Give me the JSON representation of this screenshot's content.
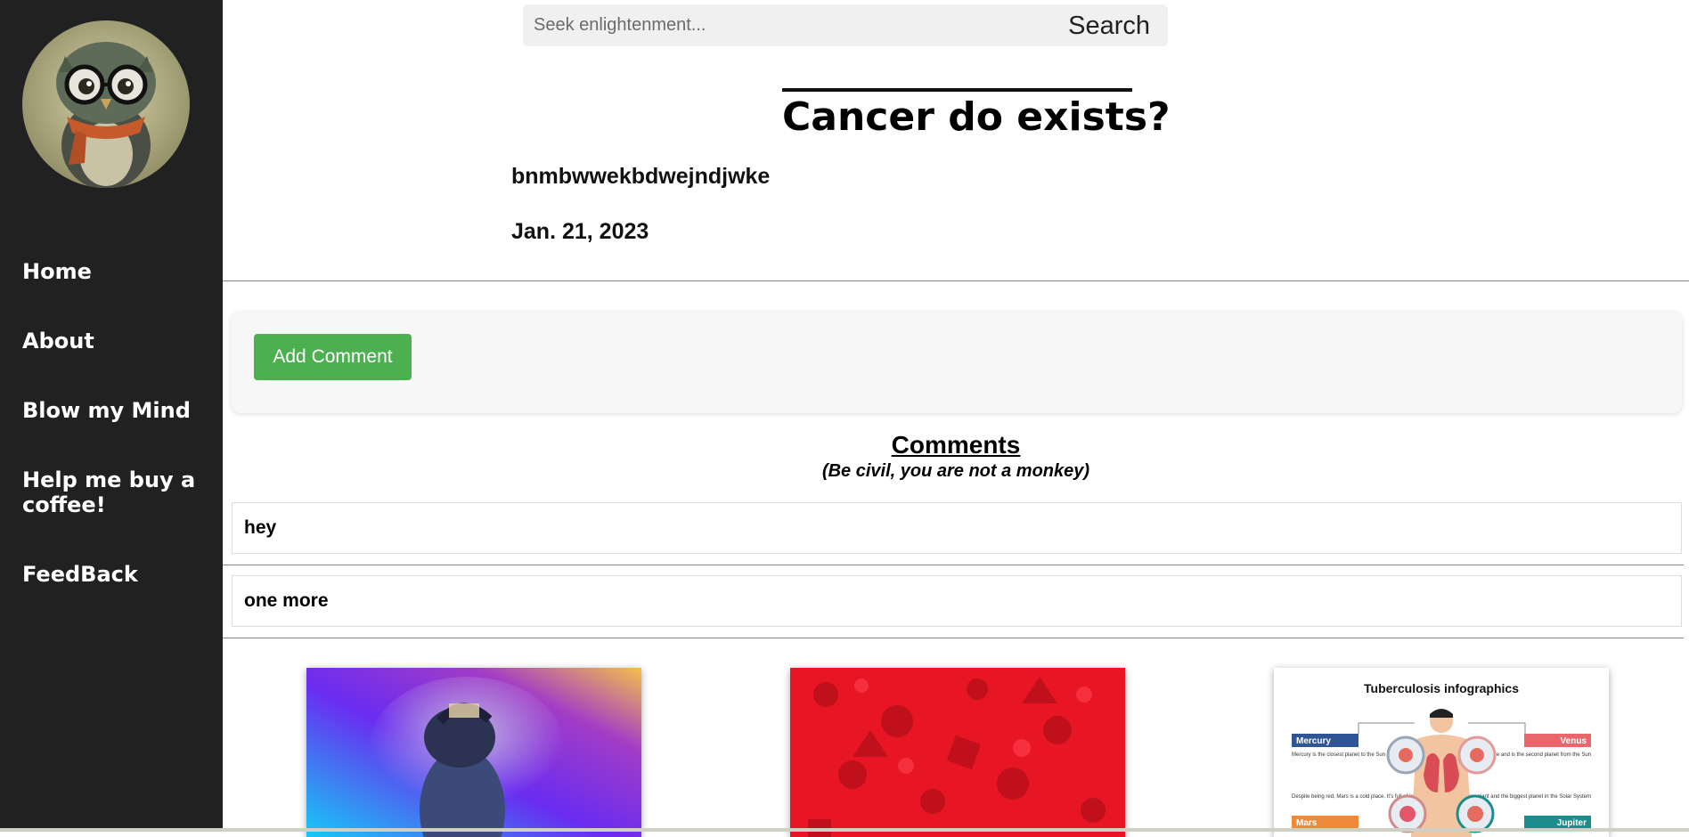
{
  "sidebar": {
    "items": [
      {
        "label": "Home"
      },
      {
        "label": "About"
      },
      {
        "label": "Blow my Mind"
      },
      {
        "label": "Help me buy a coffee!"
      },
      {
        "label": "FeedBack"
      }
    ]
  },
  "search": {
    "placeholder": "Seek enlightenment...",
    "button_label": "Search"
  },
  "post": {
    "title": "Cancer do exists?",
    "body": "bnmbwwekbdwejndjwke",
    "date": "Jan. 21, 2023"
  },
  "add_comment_label": "Add Comment",
  "comments": {
    "heading": "Comments",
    "subheading": "(Be civil, you are not a monkey)",
    "items": [
      {
        "text": "hey"
      },
      {
        "text": "one more"
      }
    ]
  },
  "related": {
    "infographic": {
      "title": "Tuberculosis infographics",
      "labels": [
        "Mercury",
        "Venus",
        "Mars",
        "Jupiter"
      ],
      "texts": [
        "Mercury is the closest planet to the Sun and the smallest of them all",
        "Venus has a beautiful name and is the second planet from the Sun",
        "Despite being red, Mars is a cold place. It's full of iron oxide dust",
        "Jupiter is a gas giant and the biggest planet in the Solar System"
      ]
    }
  },
  "colors": {
    "sidebar_bg": "#212121",
    "accent_green": "#4caf50"
  }
}
